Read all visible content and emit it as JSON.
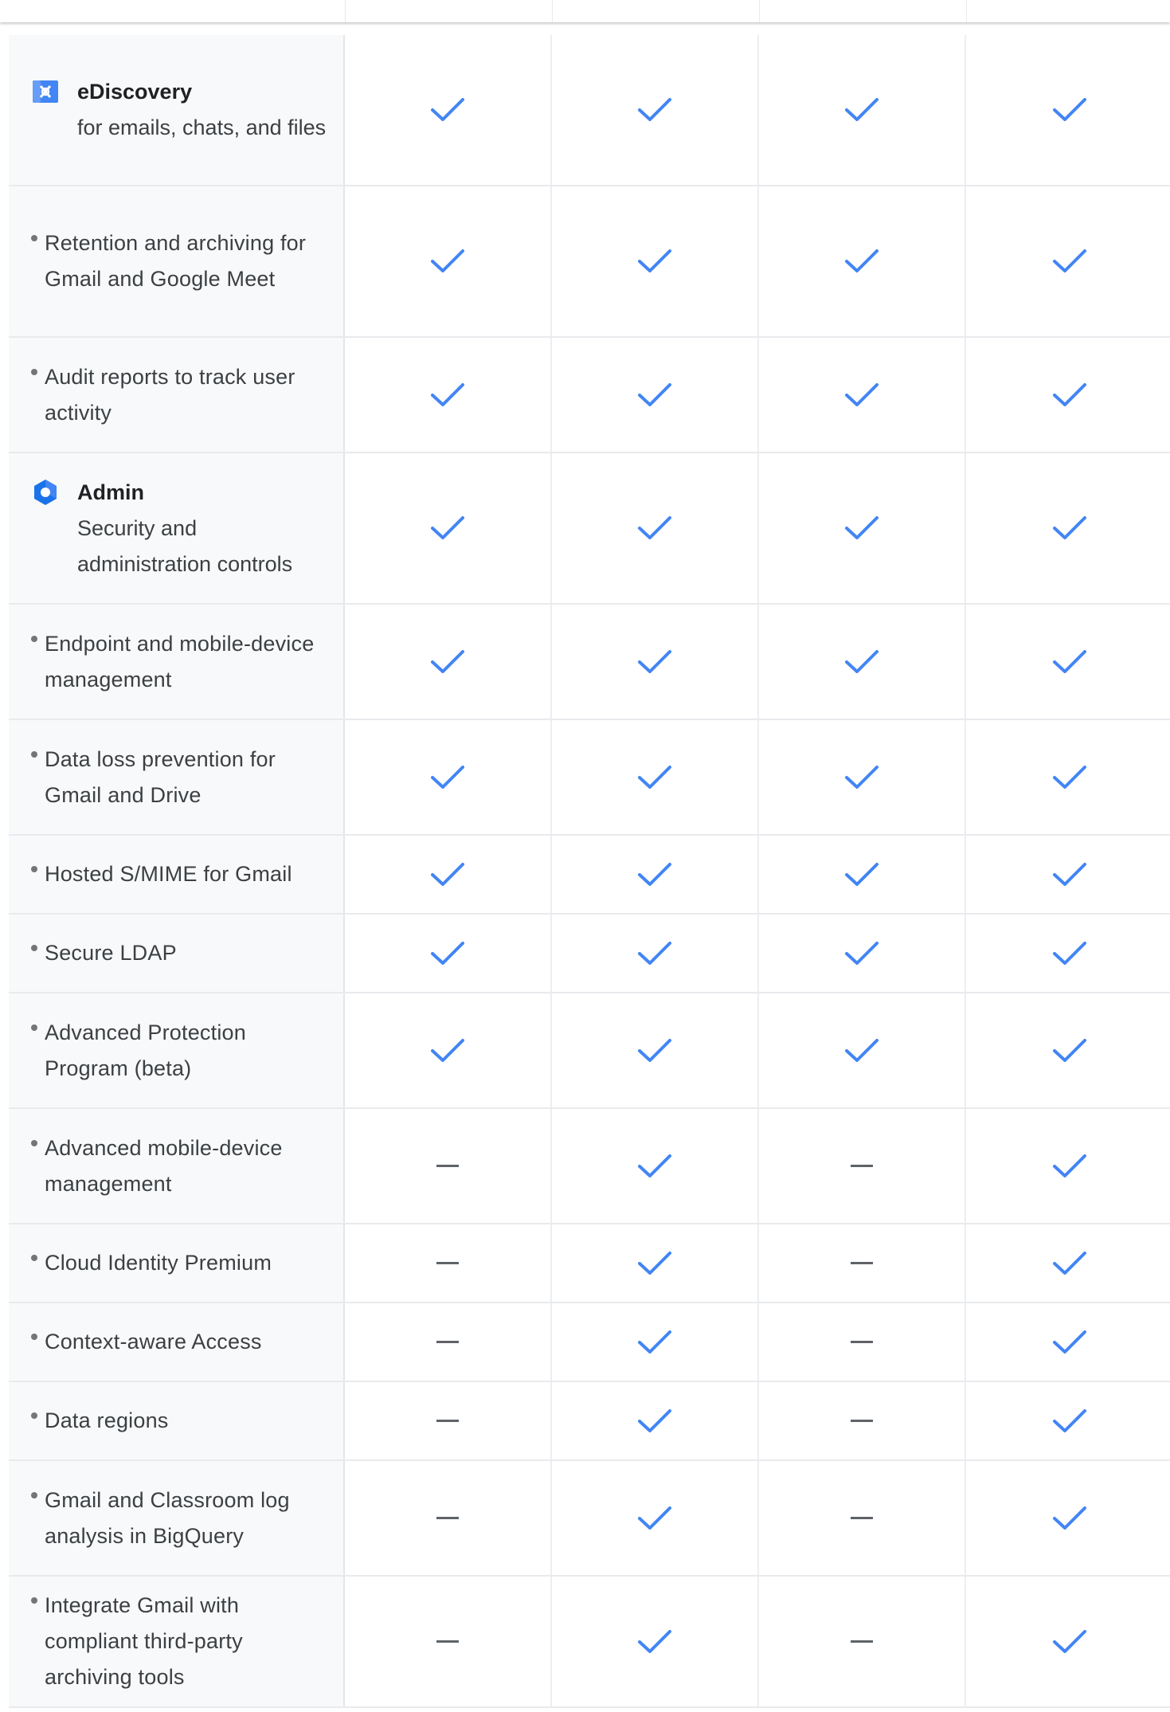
{
  "colors": {
    "check": "#4285f4",
    "dash": "#5f6368",
    "label_background": "#f8f9fa"
  },
  "rows": [
    {
      "kind": "product",
      "icon": "ediscovery-icon",
      "title": "eDiscovery",
      "desc": "for emails, chats, and files",
      "values": [
        true,
        true,
        true,
        true
      ]
    },
    {
      "kind": "feature",
      "label": "Retention and archiving for Gmail and Google Meet",
      "values": [
        true,
        true,
        true,
        true
      ]
    },
    {
      "kind": "feature",
      "label": "Audit reports to track user activity",
      "values": [
        true,
        true,
        true,
        true
      ]
    },
    {
      "kind": "product",
      "icon": "admin-icon",
      "title": "Admin",
      "desc": "Security and administration controls",
      "values": [
        true,
        true,
        true,
        true
      ]
    },
    {
      "kind": "feature",
      "label": "Endpoint and mobile-device management",
      "values": [
        true,
        true,
        true,
        true
      ]
    },
    {
      "kind": "feature",
      "label": "Data loss prevention for Gmail and Drive",
      "values": [
        true,
        true,
        true,
        true
      ]
    },
    {
      "kind": "feature",
      "label": "Hosted S/MIME for Gmail",
      "values": [
        true,
        true,
        true,
        true
      ]
    },
    {
      "kind": "feature",
      "label": "Secure LDAP",
      "values": [
        true,
        true,
        true,
        true
      ]
    },
    {
      "kind": "feature",
      "label": "Advanced Protection Program (beta)",
      "values": [
        true,
        true,
        true,
        true
      ]
    },
    {
      "kind": "feature",
      "label": "Advanced mobile-device management",
      "values": [
        false,
        true,
        false,
        true
      ]
    },
    {
      "kind": "feature",
      "label": "Cloud Identity Premium",
      "values": [
        false,
        true,
        false,
        true
      ]
    },
    {
      "kind": "feature",
      "label": "Context-aware Access",
      "values": [
        false,
        true,
        false,
        true
      ]
    },
    {
      "kind": "feature",
      "label": "Data regions",
      "values": [
        false,
        true,
        false,
        true
      ]
    },
    {
      "kind": "feature",
      "label": "Gmail and Classroom log analysis in BigQuery",
      "values": [
        false,
        true,
        false,
        true
      ]
    },
    {
      "kind": "feature",
      "label": "Integrate Gmail with compliant third-party archiving tools",
      "values": [
        false,
        true,
        false,
        true
      ]
    }
  ]
}
